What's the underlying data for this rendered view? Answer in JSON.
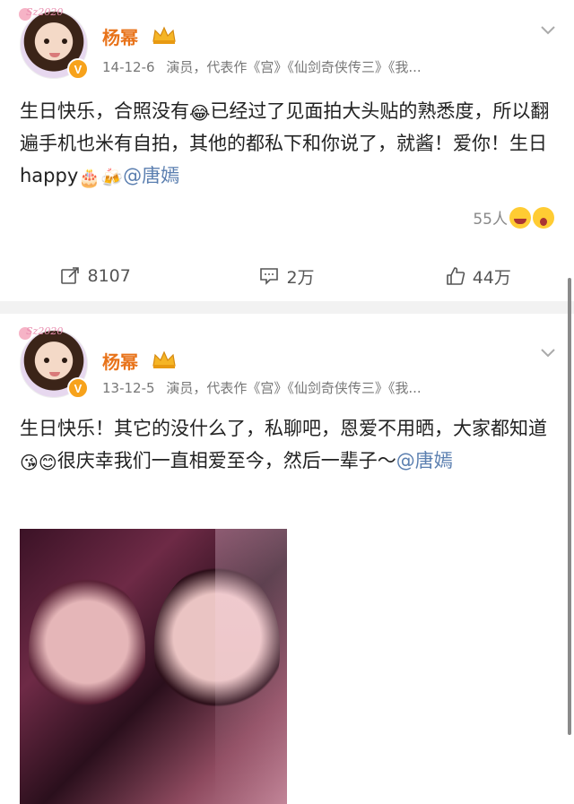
{
  "posts": [
    {
      "author": "杨幂",
      "avatar_deco": "Sz2020",
      "verified_badge": "V",
      "date": "14-12-6",
      "description": "演员，代表作《宫》《仙剑奇侠传三》《我...",
      "text_part1": "生日快乐，合照没有",
      "emoji1": "😂",
      "text_part2": "已经过了见面拍大头贴的熟悉度，所以翻遍手机也米有自拍，其他的都私下和你说了，就酱！爱你！生日happy",
      "emoji2": "🎂",
      "emoji3": "🍻",
      "mention": "@唐嫣",
      "likes_line": "55人",
      "reposts": "8107",
      "comments": "2万",
      "likes": "44万"
    },
    {
      "author": "杨幂",
      "avatar_deco": "Sz2020",
      "verified_badge": "V",
      "date": "13-12-5",
      "description": "演员，代表作《宫》《仙剑奇侠传三》《我...",
      "text_part1": "生日快乐！其它的没什么了，私聊吧，恩爱不用晒，大家都知道",
      "emoji1": "😘",
      "emoji2": "😊",
      "text_part2": "很庆幸我们一直相爱至今，然后一辈子～",
      "mention": "@唐嫣"
    }
  ],
  "icons": {
    "crown": "crown-icon",
    "chevron": "chevron-down-icon",
    "repost": "repost-icon",
    "comment": "comment-icon",
    "like": "thumbs-up-icon"
  },
  "colors": {
    "name": "#e8731a",
    "mention": "#5b7fb0",
    "verified": "#f7a21b"
  }
}
